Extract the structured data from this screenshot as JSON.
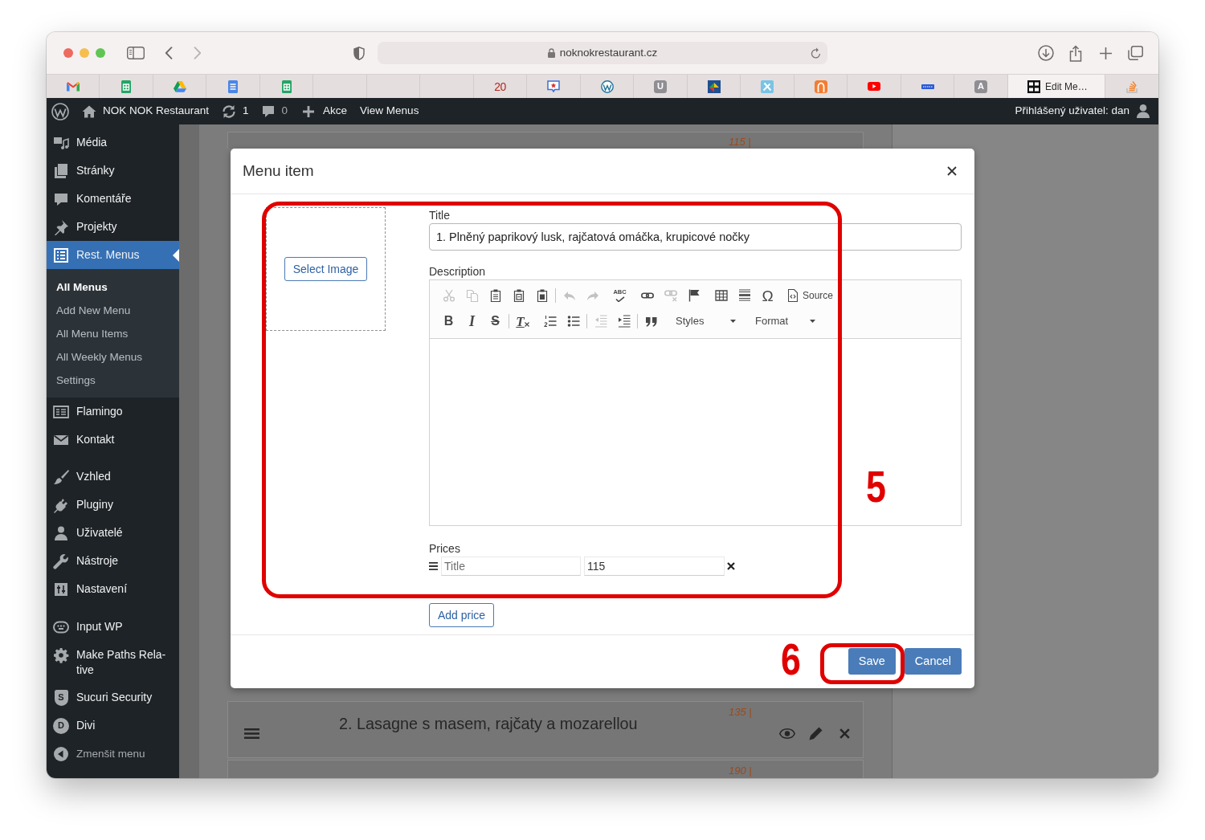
{
  "browser": {
    "address": "noknokrestaurant.cz",
    "tabs": [
      {
        "kind": "mail",
        "selected": false
      },
      {
        "kind": "sheet",
        "selected": false
      },
      {
        "kind": "drive",
        "selected": false
      },
      {
        "kind": "doc",
        "selected": false
      },
      {
        "kind": "sheet",
        "selected": false
      },
      {
        "kind": "blank",
        "selected": false
      },
      {
        "kind": "blank",
        "selected": false
      },
      {
        "kind": "blank",
        "selected": false
      },
      {
        "kind": "date",
        "glyph": "20",
        "selected": false
      },
      {
        "kind": "badge",
        "selected": false
      },
      {
        "kind": "wp",
        "selected": false
      },
      {
        "kind": "tile",
        "glyph": "U",
        "selected": false
      },
      {
        "kind": "blocks",
        "selected": false
      },
      {
        "kind": "tools",
        "selected": false
      },
      {
        "kind": "arch",
        "selected": false
      },
      {
        "kind": "video",
        "selected": false
      },
      {
        "kind": "ticket",
        "selected": false
      },
      {
        "kind": "tile",
        "glyph": "A",
        "selected": false
      },
      {
        "kind": "site",
        "title": "Edit Me…",
        "selected": true
      },
      {
        "kind": "stack",
        "selected": false
      }
    ]
  },
  "admin_bar": {
    "site": "NOK NOK Restaurant",
    "updates": "1",
    "comments": "0",
    "new": "Akce",
    "view": "View Menus",
    "account": "Přihlášený uživatel: dan"
  },
  "sidebar": {
    "groups": [
      {
        "items": [
          {
            "label": "Média",
            "selected": false
          },
          {
            "label": "Stránky",
            "selected": false
          },
          {
            "label": "Komentáře",
            "selected": false
          },
          {
            "label": "Projekty",
            "selected": false
          },
          {
            "label": "Rest. Menus",
            "selected": true,
            "submenu": [
              {
                "label": "All Menus",
                "selected": true
              },
              {
                "label": "Add New Menu",
                "selected": false
              },
              {
                "label": "All Menu Items",
                "selected": false
              },
              {
                "label": "All Weekly Menus",
                "selected": false
              },
              {
                "label": "Settings",
                "selected": false
              }
            ]
          },
          {
            "label": "Flamingo",
            "selected": false
          },
          {
            "label": "Kontakt",
            "selected": false
          }
        ]
      },
      {
        "items": [
          {
            "label": "Vzhled",
            "selected": false
          },
          {
            "label": "Pluginy",
            "selected": false
          },
          {
            "label": "Uživatelé",
            "selected": false
          },
          {
            "label": "Nástroje",
            "selected": false
          },
          {
            "label": "Nastavení",
            "selected": false
          }
        ]
      },
      {
        "items": [
          {
            "label": "Input WP",
            "selected": false
          },
          {
            "label": "Make Paths Rela-tive",
            "selected": false
          },
          {
            "label": "Sucuri Security",
            "glyph": "S",
            "selected": false
          },
          {
            "label": "Divi",
            "glyph": "D",
            "selected": false
          }
        ]
      }
    ],
    "collapse": "Zmenšit menu"
  },
  "list_rows": [
    {
      "price": "115 |"
    },
    {
      "title": "2. Lasagne s masem, rajčaty a mozarellou",
      "price": "135 |"
    },
    {
      "price": "190 |"
    }
  ],
  "dialog": {
    "title": "Menu item",
    "image_button": "Select Image",
    "title_label": "Title",
    "title_value": "1. Plněný paprikový lusk, rajčatová omáčka, krupicové nočky",
    "description_label": "Description",
    "toolbar": [
      [
        [
          {
            "kind": "cut",
            "disabled": true
          },
          {
            "kind": "copy",
            "disabled": true
          },
          {
            "kind": "paste",
            "disabled": false
          },
          {
            "kind": "pastetext",
            "disabled": false
          },
          {
            "kind": "pasteword",
            "disabled": false
          },
          {
            "kind": "separator"
          },
          {
            "kind": "undo",
            "disabled": true
          },
          {
            "kind": "redo",
            "disabled": true
          }
        ],
        [
          {
            "kind": "spell",
            "glyph": "ABC",
            "disabled": false
          }
        ],
        [
          {
            "kind": "link",
            "disabled": false
          },
          {
            "kind": "unlink",
            "disabled": true
          },
          {
            "kind": "anchor",
            "disabled": false
          }
        ],
        [
          {
            "kind": "table",
            "disabled": false
          },
          {
            "kind": "rule",
            "disabled": false
          },
          {
            "kind": "symbol",
            "glyph": "Ω",
            "disabled": false
          }
        ],
        [
          {
            "kind": "source",
            "label": "Source",
            "disabled": false
          }
        ]
      ],
      [
        [
          {
            "kind": "bold",
            "glyph": "B",
            "disabled": false
          },
          {
            "kind": "italic",
            "glyph": "I",
            "disabled": false
          },
          {
            "kind": "strike",
            "glyph": "S",
            "disabled": false
          },
          {
            "kind": "separator"
          },
          {
            "kind": "clear",
            "glyph": "T",
            "disabled": false
          }
        ],
        [
          {
            "kind": "numbered",
            "disabled": false
          },
          {
            "kind": "bulleted",
            "disabled": false
          },
          {
            "kind": "separator"
          },
          {
            "kind": "outdent",
            "disabled": true
          },
          {
            "kind": "indent",
            "disabled": false
          },
          {
            "kind": "separator"
          },
          {
            "kind": "quote",
            "disabled": false
          }
        ],
        [
          {
            "kind": "dropdown",
            "label": "Styles"
          },
          {
            "kind": "dropdown",
            "label": "Format"
          }
        ]
      ]
    ],
    "prices_label": "Prices",
    "prices": [
      {
        "name": {
          "placeholder": "Title"
        },
        "amount": {
          "value": "115"
        }
      }
    ],
    "add_price": "Add price",
    "buttons": [
      {
        "label": "Save"
      },
      {
        "label": "Cancel"
      }
    ]
  },
  "annotations": [
    {
      "number": "5"
    },
    {
      "number": "6"
    }
  ]
}
